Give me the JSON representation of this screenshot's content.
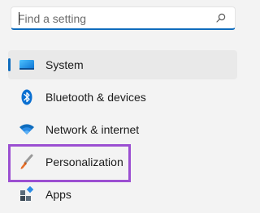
{
  "search": {
    "placeholder": "Find a setting",
    "icon": "search-icon"
  },
  "nav": {
    "items": [
      {
        "label": "System",
        "icon": "monitor-icon",
        "selected": true
      },
      {
        "label": "Bluetooth & devices",
        "icon": "bluetooth-icon",
        "selected": false
      },
      {
        "label": "Network & internet",
        "icon": "wifi-icon",
        "selected": false
      },
      {
        "label": "Personalization",
        "icon": "paintbrush-icon",
        "selected": false
      },
      {
        "label": "Apps",
        "icon": "apps-icon",
        "selected": false
      }
    ]
  },
  "colors": {
    "accent": "#0f6cbd",
    "highlight": "#9b4fd1",
    "background": "#f3f3f3",
    "selected_background": "#e9e9e9"
  }
}
